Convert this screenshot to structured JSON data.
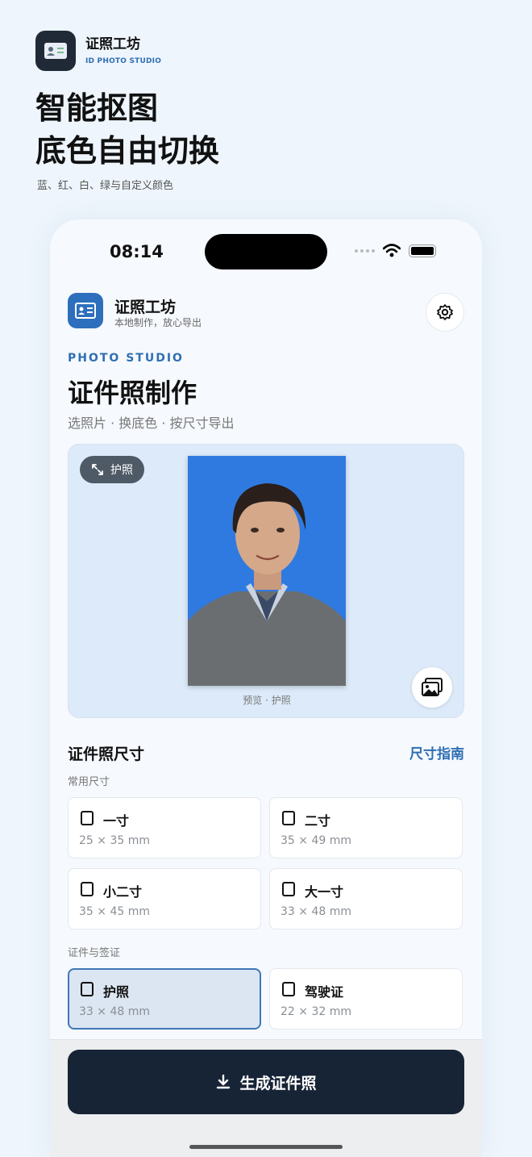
{
  "promo": {
    "brand_name": "证照工坊",
    "brand_sub": "ID PHOTO STUDIO",
    "headline_line1": "智能抠图",
    "headline_line2": "底色自由切换",
    "subline": "蓝、红、白、绿与自定义颜色",
    "logo_icon": "id-card-icon"
  },
  "status_bar": {
    "time": "08:14"
  },
  "app_header": {
    "name": "证照工坊",
    "tagline": "本地制作，放心导出",
    "logo_icon": "id-card-icon",
    "settings_icon": "gear-icon"
  },
  "hero": {
    "eyebrow": "PHOTO STUDIO",
    "title": "证件照制作",
    "subtitle": "选照片 · 换底色 · 按尺寸导出"
  },
  "preview": {
    "chip_label": "护照",
    "chip_icon": "expand-arrows-icon",
    "caption": "预览 · 护照",
    "background_color": "#2f7ae0",
    "gallery_icon": "photo-gallery-icon"
  },
  "sizes": {
    "section_title": "证件照尺寸",
    "guide_link": "尺寸指南",
    "common_label": "常用尺寸",
    "common": [
      {
        "name": "一寸",
        "dims": "25 × 35 mm"
      },
      {
        "name": "二寸",
        "dims": "35 × 49 mm"
      },
      {
        "name": "小二寸",
        "dims": "35 × 45 mm"
      },
      {
        "name": "大一寸",
        "dims": "33 × 48 mm"
      }
    ],
    "docs_label": "证件与签证",
    "docs": [
      {
        "name": "护照",
        "dims": "33 × 48 mm",
        "selected": true
      },
      {
        "name": "驾驶证",
        "dims": "22 × 32 mm",
        "selected": false
      }
    ]
  },
  "cta": {
    "label": "生成证件照",
    "icon": "download-icon"
  },
  "colors": {
    "accent": "#2f6fb3",
    "cta_bg": "#172436",
    "preview_bg": "#dceaf9"
  }
}
